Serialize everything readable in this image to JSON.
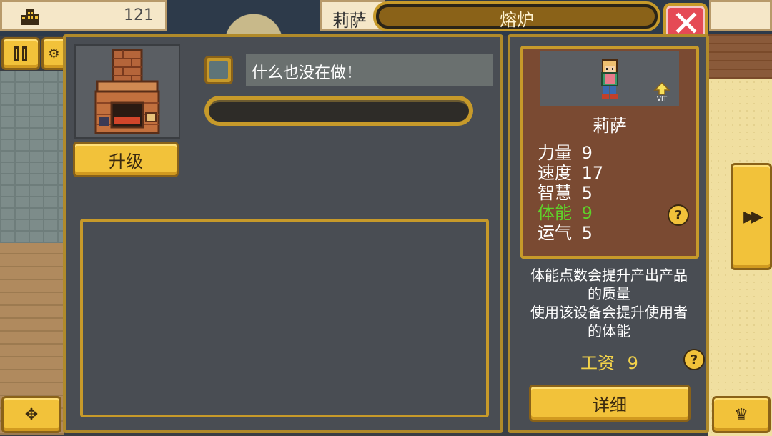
{
  "top_left": {
    "icon": "building-icon",
    "value": "121"
  },
  "header": {
    "worker_name": "莉萨",
    "facility_title": "熔炉",
    "close_icon": "close-x-icon"
  },
  "left_controls": {
    "pause_icon": "pause-icon",
    "settings_icon": "gear-icon"
  },
  "facility": {
    "image": "furnace-image",
    "upgrade_label": "升级",
    "status_text": "什么也没在做！",
    "progress": 0
  },
  "worker": {
    "name": "莉萨",
    "stats": [
      {
        "label": "力量",
        "value": "9",
        "color": "#ffffff"
      },
      {
        "label": "速度",
        "value": "17",
        "color": "#ffffff"
      },
      {
        "label": "智慧",
        "value": "5",
        "color": "#ffffff"
      },
      {
        "label": "体能",
        "value": "9",
        "color": "#5fd12a"
      },
      {
        "label": "运气",
        "value": "5",
        "color": "#ffffff"
      }
    ],
    "badge": "lvl-up-icon"
  },
  "info": {
    "line1": "体能点数会提升产出产品",
    "line2": "的质量",
    "line3": "使用该设备会提升使用者",
    "line4": "的体能",
    "wage_label": "工资",
    "wage_value": "9",
    "detail_label": "详细"
  },
  "bottom": {
    "move_icon": "move-arrows-icon",
    "crown_icon": "crown-icon",
    "next_icon": "double-arrow-right-icon"
  },
  "colors": {
    "gold": "#f2c23a",
    "panel": "#494d53",
    "border": "#b08a2a",
    "highlight_green": "#5fd12a",
    "wage_yellow": "#f2d24a"
  }
}
